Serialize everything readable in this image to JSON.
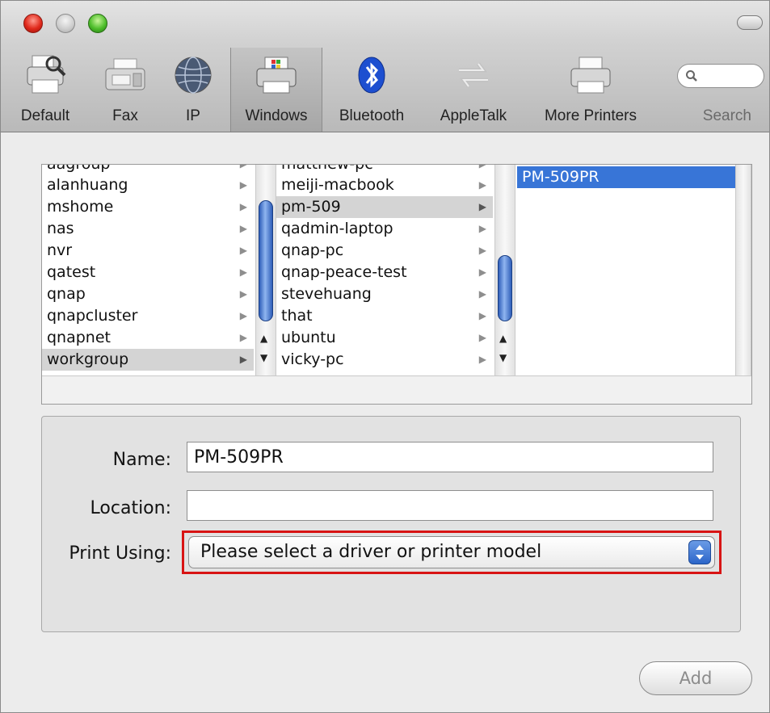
{
  "toolbar": {
    "items": [
      {
        "label": "Default",
        "icon": "default-printer-icon"
      },
      {
        "label": "Fax",
        "icon": "fax-icon"
      },
      {
        "label": "IP",
        "icon": "globe-icon"
      },
      {
        "label": "Windows",
        "icon": "windows-printer-icon",
        "selected": true
      },
      {
        "label": "Bluetooth",
        "icon": "bluetooth-icon"
      },
      {
        "label": "AppleTalk",
        "icon": "appletalk-icon"
      },
      {
        "label": "More Printers",
        "icon": "more-printers-icon"
      }
    ],
    "search_label": "Search"
  },
  "browser": {
    "column1": {
      "items": [
        "aagroup",
        "alanhuang",
        "mshome",
        "nas",
        "nvr",
        "qatest",
        "qnap",
        "qnapcluster",
        "qnapnet",
        "workgroup"
      ],
      "selected": "workgroup"
    },
    "column2": {
      "items": [
        "matthew-pc",
        "meiji-macbook",
        "pm-509",
        "qadmin-laptop",
        "qnap-pc",
        "qnap-peace-test",
        "stevehuang",
        "that",
        "ubuntu",
        "vicky-pc"
      ],
      "selected": "pm-509"
    },
    "column3": {
      "items": [
        "PM-509PR"
      ],
      "selected": "PM-509PR"
    }
  },
  "form": {
    "name_label": "Name:",
    "name_value": "PM-509PR",
    "location_label": "Location:",
    "location_value": "",
    "print_using_label": "Print Using:",
    "print_using_value": "Please select a driver or printer model"
  },
  "add_label": "Add",
  "colors": {
    "selection_blue": "#3875d7",
    "highlight_red": "#d81414"
  }
}
